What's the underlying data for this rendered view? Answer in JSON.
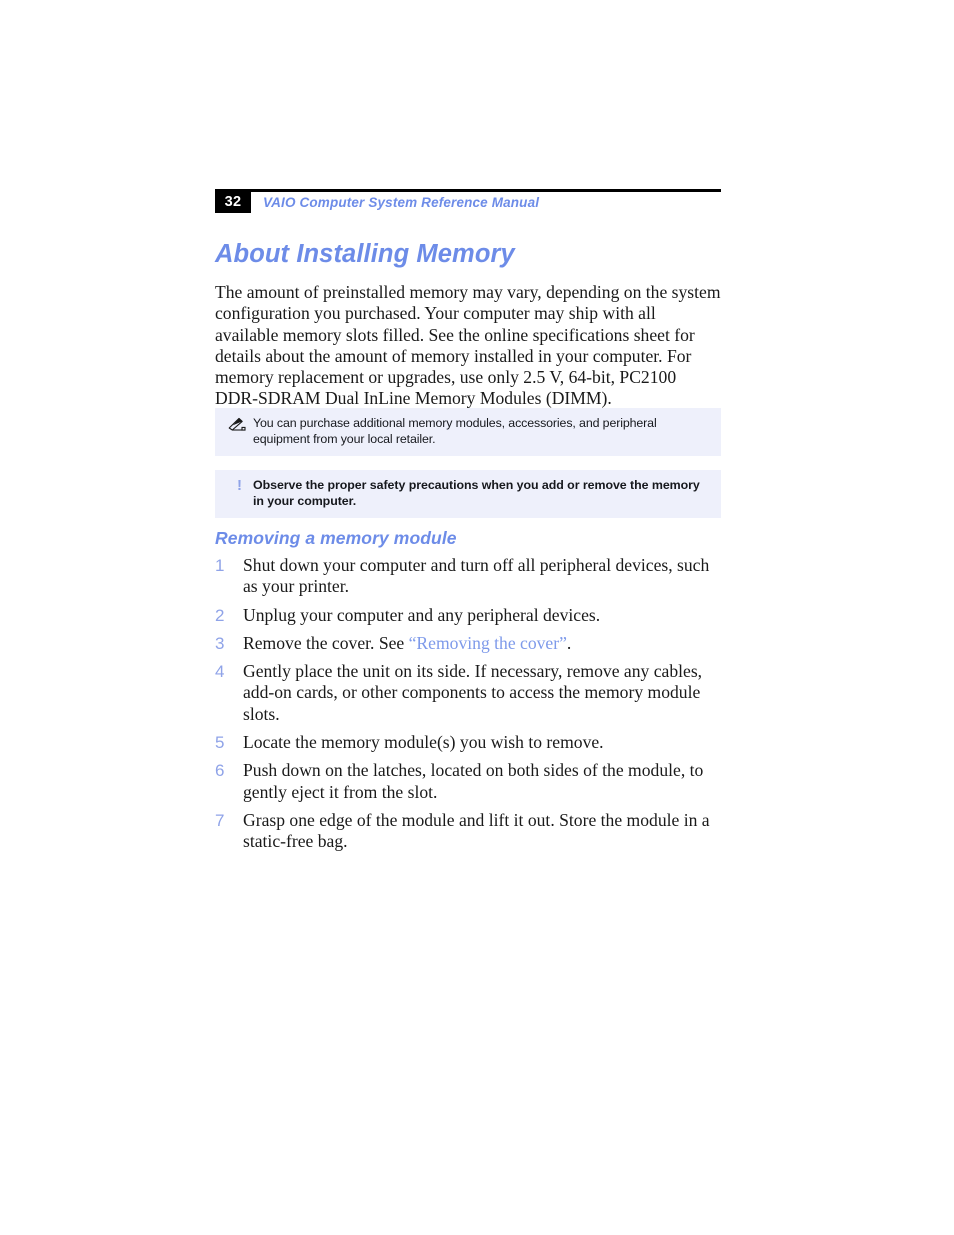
{
  "header": {
    "page_number": "32",
    "manual_title": "VAIO Computer System Reference Manual"
  },
  "main": {
    "heading": "About Installing Memory",
    "intro_paragraph": "The amount of preinstalled memory may vary, depending on the system configuration you purchased. Your computer may ship with all available memory slots filled. See the online specifications sheet for details about the amount of memory installed in your computer. For memory replacement or upgrades, use only 2.5 V, 64-bit, PC2100 DDR-SDRAM Dual InLine Memory Modules (DIMM).",
    "note_callout": {
      "icon": "note-pen-icon",
      "text": "You can purchase additional memory modules, accessories, and peripheral equipment from your local retailer."
    },
    "warning_callout": {
      "icon": "exclamation-icon",
      "marker": "!",
      "text": "Observe the proper safety precautions when you add or remove the memory in your computer."
    },
    "subheading": "Removing a memory module",
    "steps": [
      {
        "num": "1",
        "text": "Shut down your computer and turn off all peripheral devices, such as your printer."
      },
      {
        "num": "2",
        "text": "Unplug your computer and any peripheral devices."
      },
      {
        "num": "3",
        "text": "Remove the cover. See ",
        "link": "“Removing the cover”",
        "text_after": "."
      },
      {
        "num": "4",
        "text": "Gently place the unit on its side. If necessary, remove any cables, add-on cards, or other components to access the memory module slots."
      },
      {
        "num": "5",
        "text": "Locate the memory module(s) you wish to remove."
      },
      {
        "num": "6",
        "text": "Push down on the latches, located on both sides of the module, to gently eject it from the slot."
      },
      {
        "num": "7",
        "text": "Grasp one edge of the module and lift it out. Store the module in a static-free bag."
      }
    ]
  },
  "colors": {
    "accent_blue": "#6d8ce8",
    "link_blue": "#7e9aea",
    "step_number_blue": "#8fa3e8",
    "callout_background": "#eef0fb",
    "page_number_background": "#000000",
    "body_text": "#1a1a1a"
  }
}
